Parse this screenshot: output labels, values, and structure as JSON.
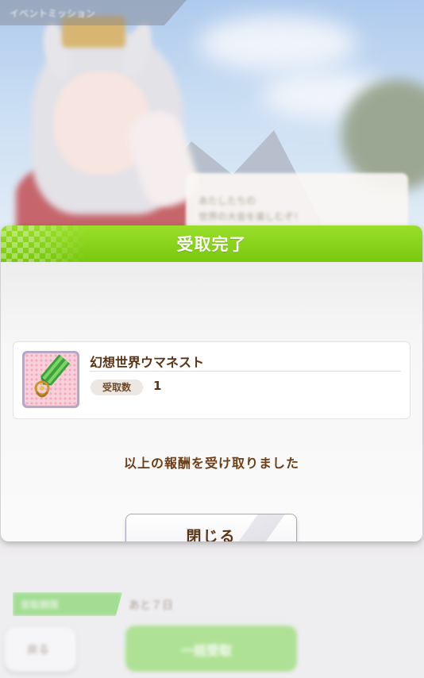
{
  "background": {
    "top_label": "イベントミッション",
    "speech_lines": [
      "あたしたちの",
      "世界の大会を楽しむぞ！"
    ],
    "deadline_label": "受取期限",
    "days_left": "あと７日",
    "back_label": "戻る",
    "bulk_receive_label": "一括受取"
  },
  "dialog": {
    "title": "受取完了",
    "item": {
      "name": "幻想世界ウマネスト",
      "qty_label": "受取数",
      "qty_value": "1",
      "icon": "medal-icon"
    },
    "message": "以上の報酬を受け取りました",
    "close_label": "閉じる"
  },
  "colors": {
    "header_green": "#86d11a",
    "text_brown": "#5a3414",
    "icon_pink": "#f9d0da",
    "button_border": "#a9a6bc"
  }
}
